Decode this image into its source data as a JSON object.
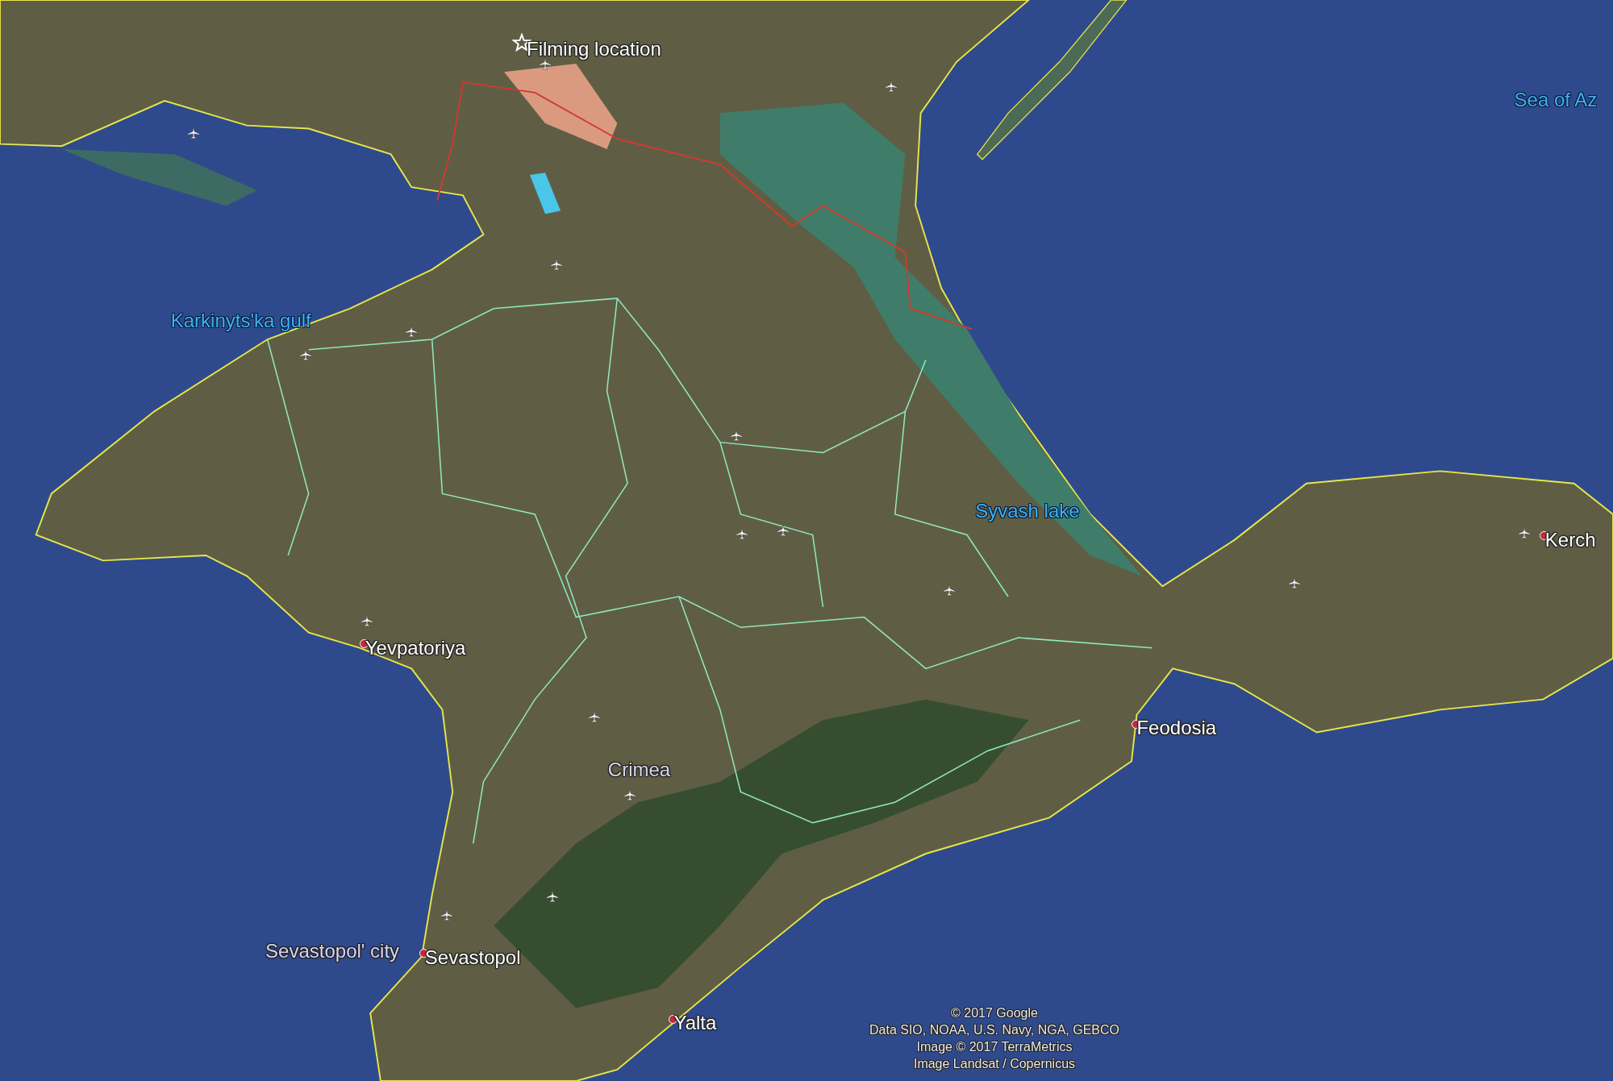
{
  "map_labels": [
    {
      "text": "Filming location",
      "kind": "marker"
    },
    {
      "text": "Sea of Az",
      "kind": "water"
    },
    {
      "text": "Karkinyts'ka gulf",
      "kind": "water"
    },
    {
      "text": "Syvash lake",
      "kind": "water"
    },
    {
      "text": "Kerch",
      "kind": "place"
    },
    {
      "text": "Yevpatoriya",
      "kind": "place"
    },
    {
      "text": "Feodosia",
      "kind": "place"
    },
    {
      "text": "Crimea",
      "kind": "region"
    },
    {
      "text": "Sevastopol' city",
      "kind": "region"
    },
    {
      "text": "Sevastopol",
      "kind": "place"
    },
    {
      "text": "Yalta",
      "kind": "place"
    }
  ],
  "attribution": [
    "© 2017 Google",
    "Data SIO, NOAA, U.S. Navy, NGA, GEBCO",
    "Image © 2017 TerraMetrics",
    "Image Landsat / Copernicus"
  ]
}
